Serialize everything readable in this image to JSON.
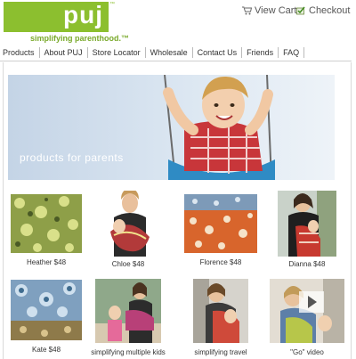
{
  "logo": {
    "text": "puj",
    "tm": "™",
    "tagline": "simplifying parenthood.™"
  },
  "top_links": {
    "view_cart": "View Cart",
    "checkout": "Checkout"
  },
  "nav": [
    "Products",
    "About PUJ",
    "Store Locator",
    "Wholesale",
    "Contact Us",
    "Friends",
    "FAQ"
  ],
  "banner": {
    "text": "products for parents"
  },
  "products_row1": [
    "Heather $48",
    "Chloe $48",
    "Florence $48",
    "Dianna $48"
  ],
  "products_row2": [
    "Kate $48",
    "simplifying multiple kids",
    "simplifying travel",
    "\"Go\" video"
  ],
  "colors": {
    "brand_green": "#8cbf2f",
    "tagline_green": "#79a92a"
  }
}
